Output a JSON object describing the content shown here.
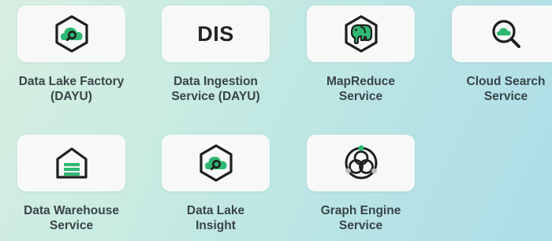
{
  "theme": {
    "accent_green": "#2eb872",
    "dark_stroke": "#1f1f1f",
    "label_color": "#394449",
    "card_color": "#f7f9f8"
  },
  "services": [
    {
      "name": "Data Lake Factory (DAYU)",
      "lines": [
        "Data Lake Factory",
        "(DAYU)"
      ],
      "icon": "hexagon-cloud-search-icon"
    },
    {
      "name": "Data Ingestion Service (DAYU)",
      "lines": [
        "Data Ingestion",
        "Service (DAYU)"
      ],
      "icon_text": "DIS"
    },
    {
      "name": "MapReduce Service",
      "lines": [
        "MapReduce",
        "Service"
      ],
      "icon": "elephant-icon"
    },
    {
      "name": "Cloud Search Service",
      "lines": [
        "Cloud Search",
        "Service"
      ],
      "icon": "magnifier-cloud-icon"
    },
    {
      "name": "Data Warehouse Service",
      "lines": [
        "Data Warehouse",
        "Service"
      ],
      "icon": "warehouse-icon"
    },
    {
      "name": "Data Lake Insight",
      "lines": [
        "Data Lake",
        "Insight"
      ],
      "icon": "hexagon-cloud-search-icon"
    },
    {
      "name": "Graph Engine Service",
      "lines": [
        "Graph Engine",
        "Service"
      ],
      "icon": "graph-circle-icon"
    }
  ]
}
